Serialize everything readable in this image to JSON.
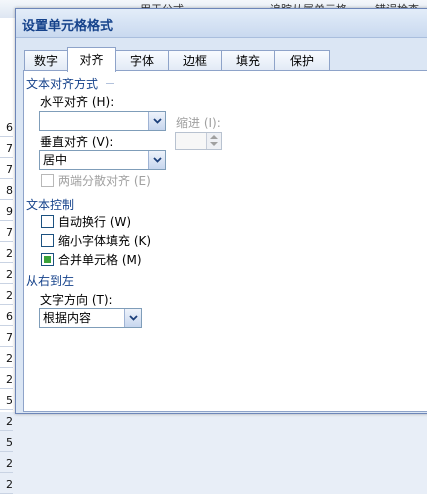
{
  "background": {
    "ribbon_text_1": "用于公式",
    "ribbon_text_2": "追踪从属单元格",
    "ribbon_text_3": "错误检查",
    "row_numbers": [
      "6",
      "7",
      "7",
      "8",
      "9",
      "7",
      "2",
      "2",
      "2",
      "6",
      "7",
      "2",
      "2",
      "5",
      "2",
      "5",
      "2",
      "2"
    ]
  },
  "dialog": {
    "title": "设置单元格格式",
    "tabs": [
      "数字",
      "对齐",
      "字体",
      "边框",
      "填充",
      "保护"
    ],
    "active_tab": "对齐"
  },
  "text_alignment": {
    "section_title": "文本对齐方式",
    "horizontal_label": "水平对齐 (H):",
    "horizontal_value": "",
    "indent_label": "缩进 (I):",
    "indent_value": "",
    "vertical_label": "垂直对齐 (V):",
    "vertical_value": "居中",
    "justify_distributed_label": "两端分散对齐 (E)",
    "justify_distributed_checked": false
  },
  "text_control": {
    "section_title": "文本控制",
    "wrap_text_label": "自动换行 (W)",
    "wrap_text_checked": false,
    "shrink_to_fit_label": "缩小字体填充 (K)",
    "shrink_to_fit_checked": false,
    "merge_cells_label": "合并单元格 (M)",
    "merge_cells_checked": true
  },
  "right_to_left": {
    "section_title": "从右到左",
    "direction_label": "文字方向 (T):",
    "direction_value": "根据内容"
  }
}
